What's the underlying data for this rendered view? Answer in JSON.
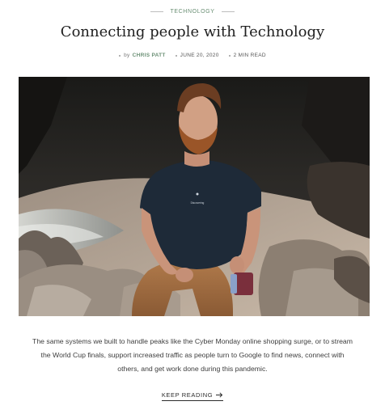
{
  "post": {
    "category": "TECHNOLOGY",
    "title": "Connecting people with Technology",
    "meta": {
      "by_label": "by",
      "author": "CHRIS PATT",
      "date": "JUNE 20, 2020",
      "read_time": "2 MIN READ"
    },
    "image": {
      "shirt_text": "Discovering"
    },
    "excerpt": "The same systems we built to handle peaks like the Cyber Monday online shopping surge, or to stream the World Cup finals, support increased traffic as people turn to Google to find news, connect with others, and get work done during this pandemic.",
    "keep_reading_label": "KEEP READING",
    "keep_reading_icon": "arrow-right-icon"
  },
  "colors": {
    "accent": "#6a8f74",
    "text": "#2b2b2b",
    "background": "#ffffff"
  }
}
